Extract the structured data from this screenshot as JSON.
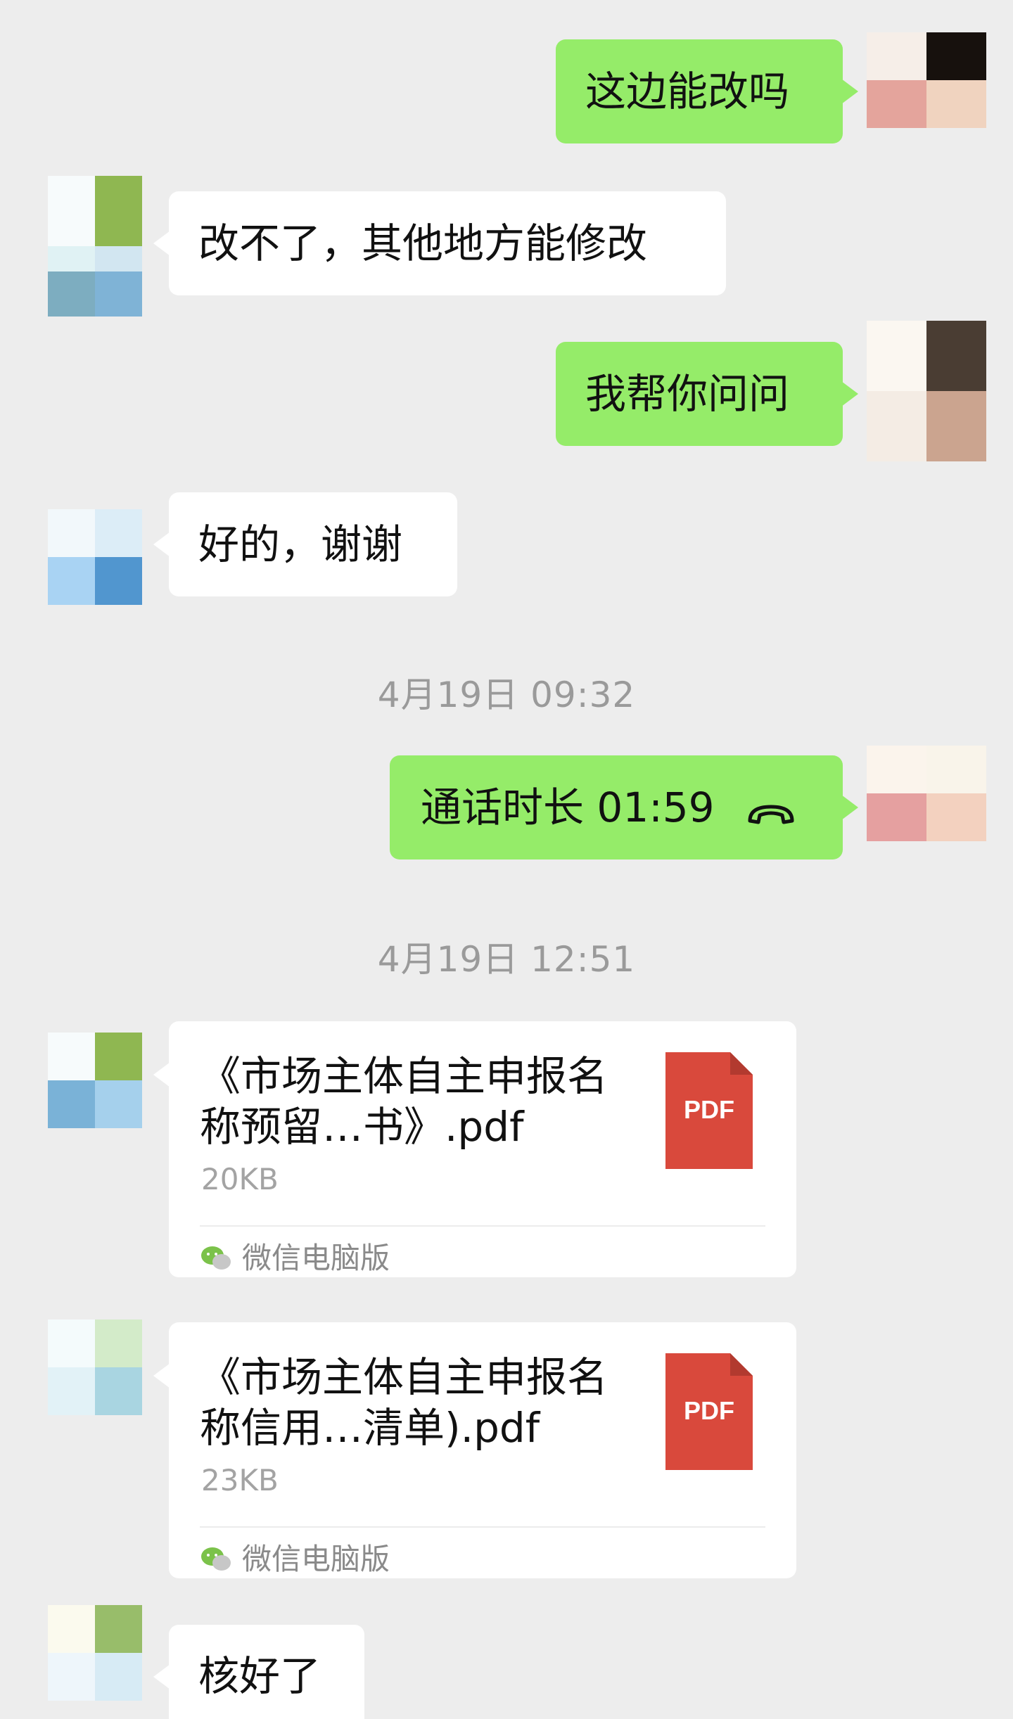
{
  "colors": {
    "background": "#ededed",
    "my_bubble": "#95ec69",
    "their_bubble": "#ffffff",
    "timestamp": "#9a9a9a",
    "pdf_red": "#d9493c"
  },
  "messages": [
    {
      "side": "me",
      "text": "这边能改吗"
    },
    {
      "side": "them",
      "text": "改不了，其他地方能修改"
    },
    {
      "side": "me",
      "text": "我帮你问问"
    },
    {
      "side": "them",
      "text": "好的，谢谢"
    }
  ],
  "timestamps": [
    "4月19日 09:32",
    "4月19日 12:51"
  ],
  "call": {
    "label": "通话时长 01:59",
    "icon": "phone-hangup-icon"
  },
  "files": [
    {
      "title": "《市场主体自主申报名称预留…书》.pdf",
      "size": "20KB",
      "badge": "PDF",
      "source": "微信电脑版"
    },
    {
      "title": "《市场主体自主申报名称信用…清单).pdf",
      "size": "23KB",
      "badge": "PDF",
      "source": "微信电脑版"
    }
  ],
  "last_message": {
    "side": "them",
    "text": "核好了"
  }
}
